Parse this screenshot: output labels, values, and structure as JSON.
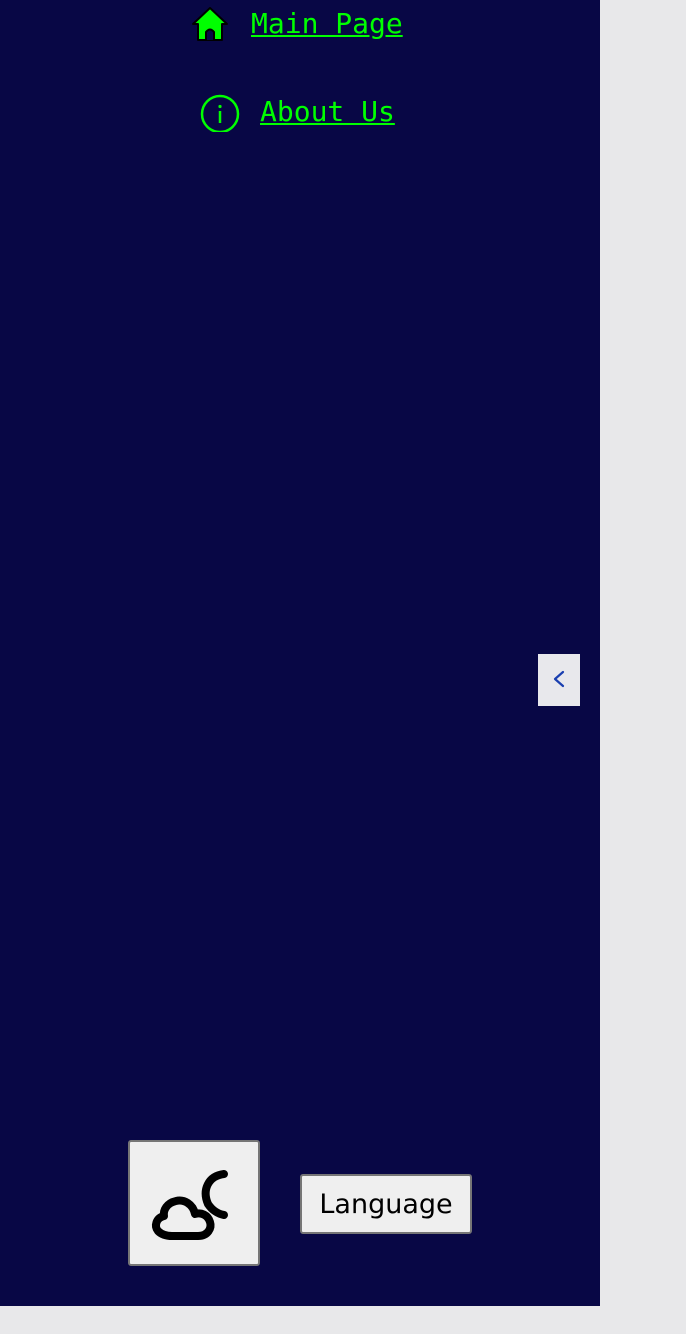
{
  "nav": {
    "items": [
      {
        "label": "Main Page",
        "icon": "home-icon"
      },
      {
        "label": "About Us",
        "icon": "info-icon"
      }
    ]
  },
  "sidebar": {
    "background_color": "#080745",
    "link_color": "#00ff00",
    "collapse_icon": "chevron-left-icon"
  },
  "footer": {
    "theme_icon": "cloud-moon-icon",
    "language_label": "Language"
  }
}
